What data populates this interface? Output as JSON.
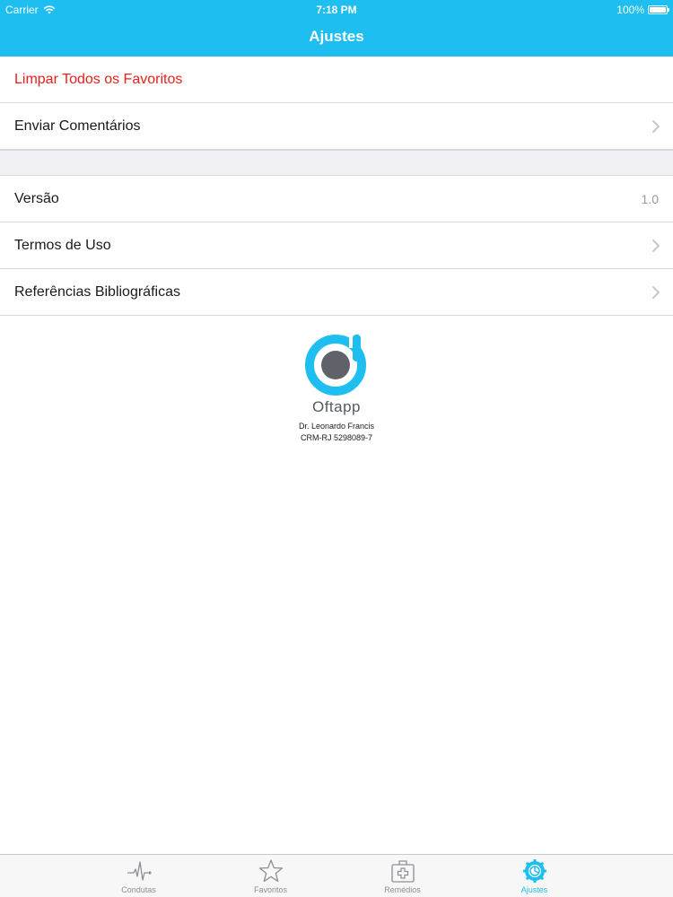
{
  "status_bar": {
    "carrier": "Carrier",
    "time": "7:18 PM",
    "battery": "100%"
  },
  "nav": {
    "title": "Ajustes"
  },
  "settings": {
    "clear_favorites": "Limpar Todos os Favoritos",
    "send_feedback": "Enviar Comentários",
    "version_label": "Versão",
    "version_value": "1.0",
    "terms": "Termos de Uso",
    "references": "Referências Bibliográficas"
  },
  "about": {
    "app_name": "Oftapp",
    "author": "Dr. Leonardo Francis",
    "registration": "CRM-RJ 5298089-7"
  },
  "tabs": [
    {
      "label": "Condutas",
      "icon": "pulse-icon",
      "active": false
    },
    {
      "label": "Favoritos",
      "icon": "star-icon",
      "active": false
    },
    {
      "label": "Remédios",
      "icon": "medical-kit-icon",
      "active": false
    },
    {
      "label": "Ajustes",
      "icon": "gear-icon",
      "active": true
    }
  ],
  "colors": {
    "accent": "#1ebef0",
    "danger": "#e8201b",
    "inactive": "#8e8e93"
  }
}
